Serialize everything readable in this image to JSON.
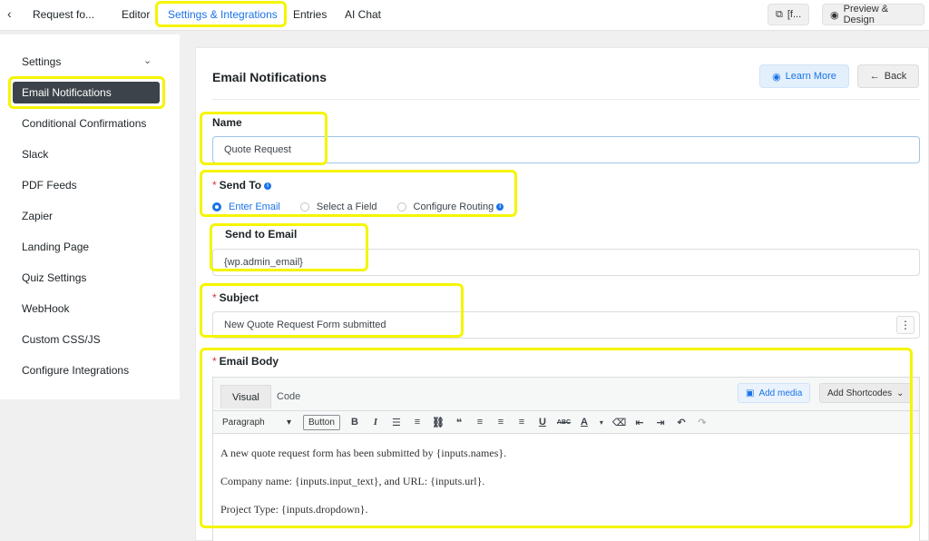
{
  "topbar": {
    "back_glyph": "‹",
    "form_title": "Request fo...",
    "tabs": [
      "Editor",
      "Settings & Integrations",
      "Entries",
      "AI Chat"
    ],
    "active_tab": "Settings & Integrations",
    "shortcode_btn": "[f...",
    "preview_btn": "Preview & Design"
  },
  "sidebar": {
    "items": [
      "Settings",
      "Email Notifications",
      "Conditional Confirmations",
      "Slack",
      "PDF Feeds",
      "Zapier",
      "Landing Page",
      "Quiz Settings",
      "WebHook",
      "Custom CSS/JS",
      "Configure Integrations"
    ],
    "active": "Email Notifications"
  },
  "panel": {
    "title": "Email Notifications",
    "learn_more": "Learn More",
    "back": "Back"
  },
  "form": {
    "name_label": "Name",
    "name_value": "Quote Request",
    "send_to_label": "Send To",
    "send_to_options": [
      "Enter Email",
      "Select a Field",
      "Configure Routing"
    ],
    "send_to_selected": "Enter Email",
    "send_to_email_label": "Send to Email",
    "send_to_email_value": "{wp.admin_email}",
    "subject_label": "Subject",
    "subject_value": "New Quote Request Form submitted",
    "email_body_label": "Email Body"
  },
  "editor": {
    "tabs": [
      "Visual",
      "Code"
    ],
    "active_tab": "Visual",
    "add_media": "Add media",
    "add_shortcodes": "Add Shortcodes",
    "paragraph_select": "Paragraph",
    "button_label": "Button",
    "body_lines": [
      "A new quote request form has been submitted by {inputs.names}.",
      "Company name: {inputs.input_text}, and URL: {inputs.url}.",
      "Project Type: {inputs.dropdown}."
    ]
  },
  "colors": {
    "accent": "#1a73e8",
    "highlight": "#f5f500",
    "sidebar_active": "#3c434a",
    "required": "#d63638"
  }
}
